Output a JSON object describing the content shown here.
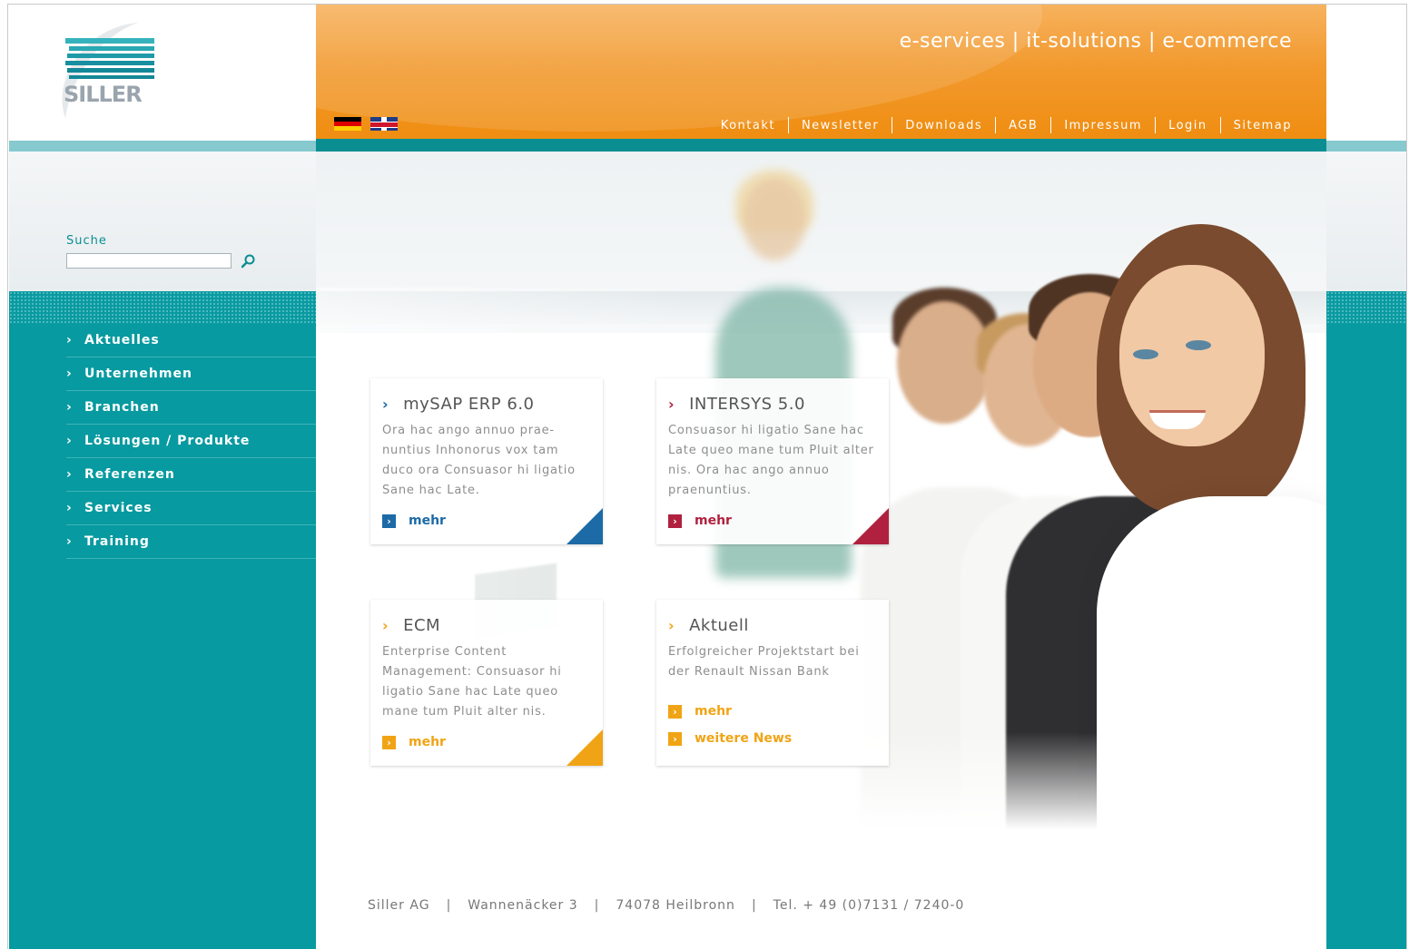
{
  "logo": {
    "text": "SILLER"
  },
  "header": {
    "tagline": "e-services | it-solutions | e-commerce",
    "languages": [
      {
        "name": "flag-de-icon",
        "code": "de"
      },
      {
        "name": "flag-uk-icon",
        "code": "en"
      }
    ],
    "topnav": [
      "Kontakt",
      "Newsletter",
      "Downloads",
      "AGB",
      "Impressum",
      "Login",
      "Sitemap"
    ]
  },
  "search": {
    "label": "Suche",
    "value": "",
    "placeholder": "",
    "icon": "search-icon"
  },
  "sidebar": {
    "items": [
      {
        "label": "Aktuelles"
      },
      {
        "label": "Unternehmen"
      },
      {
        "label": "Branchen"
      },
      {
        "label": "Lösungen / Produkte"
      },
      {
        "label": "Referenzen"
      },
      {
        "label": "Services"
      },
      {
        "label": "Training"
      }
    ]
  },
  "cards": [
    {
      "title": "mySAP ERP 6.0",
      "text": "Ora hac ango annuo prae-nuntius Inhonorus vox tam duco ora Consuasor hi ligatio Sane hac Late.",
      "links": [
        "mehr"
      ],
      "color": "#1c6aa6"
    },
    {
      "title": "INTERSYS 5.0",
      "text": "Consuasor hi ligatio Sane hac Late queo mane tum Pluit alter nis. Ora hac ango annuo praenuntius.",
      "links": [
        "mehr"
      ],
      "color": "#b0213f"
    },
    {
      "title": "ECM",
      "text": "Enterprise Content Management: Consuasor hi ligatio Sane hac Late queo mane tum Pluit alter nis.",
      "links": [
        "mehr"
      ],
      "color": "#f0a415"
    },
    {
      "title": "Aktuell",
      "text": "Erfolgreicher Projektstart bei der Renault Nissan Bank",
      "links": [
        "mehr",
        "weitere News"
      ],
      "color": "#f0a415"
    }
  ],
  "footer": {
    "parts": [
      "Siller AG",
      "Wannenäcker 3",
      "74078 Heilbronn",
      "Tel. + 49 (0)7131 / 7240-0"
    ],
    "separator": "|"
  },
  "colors": {
    "header_orange": "#f29a2f",
    "teal": "#079aa0",
    "teal_dark": "#0a8e92",
    "light_cyan": "#86c9cf"
  }
}
